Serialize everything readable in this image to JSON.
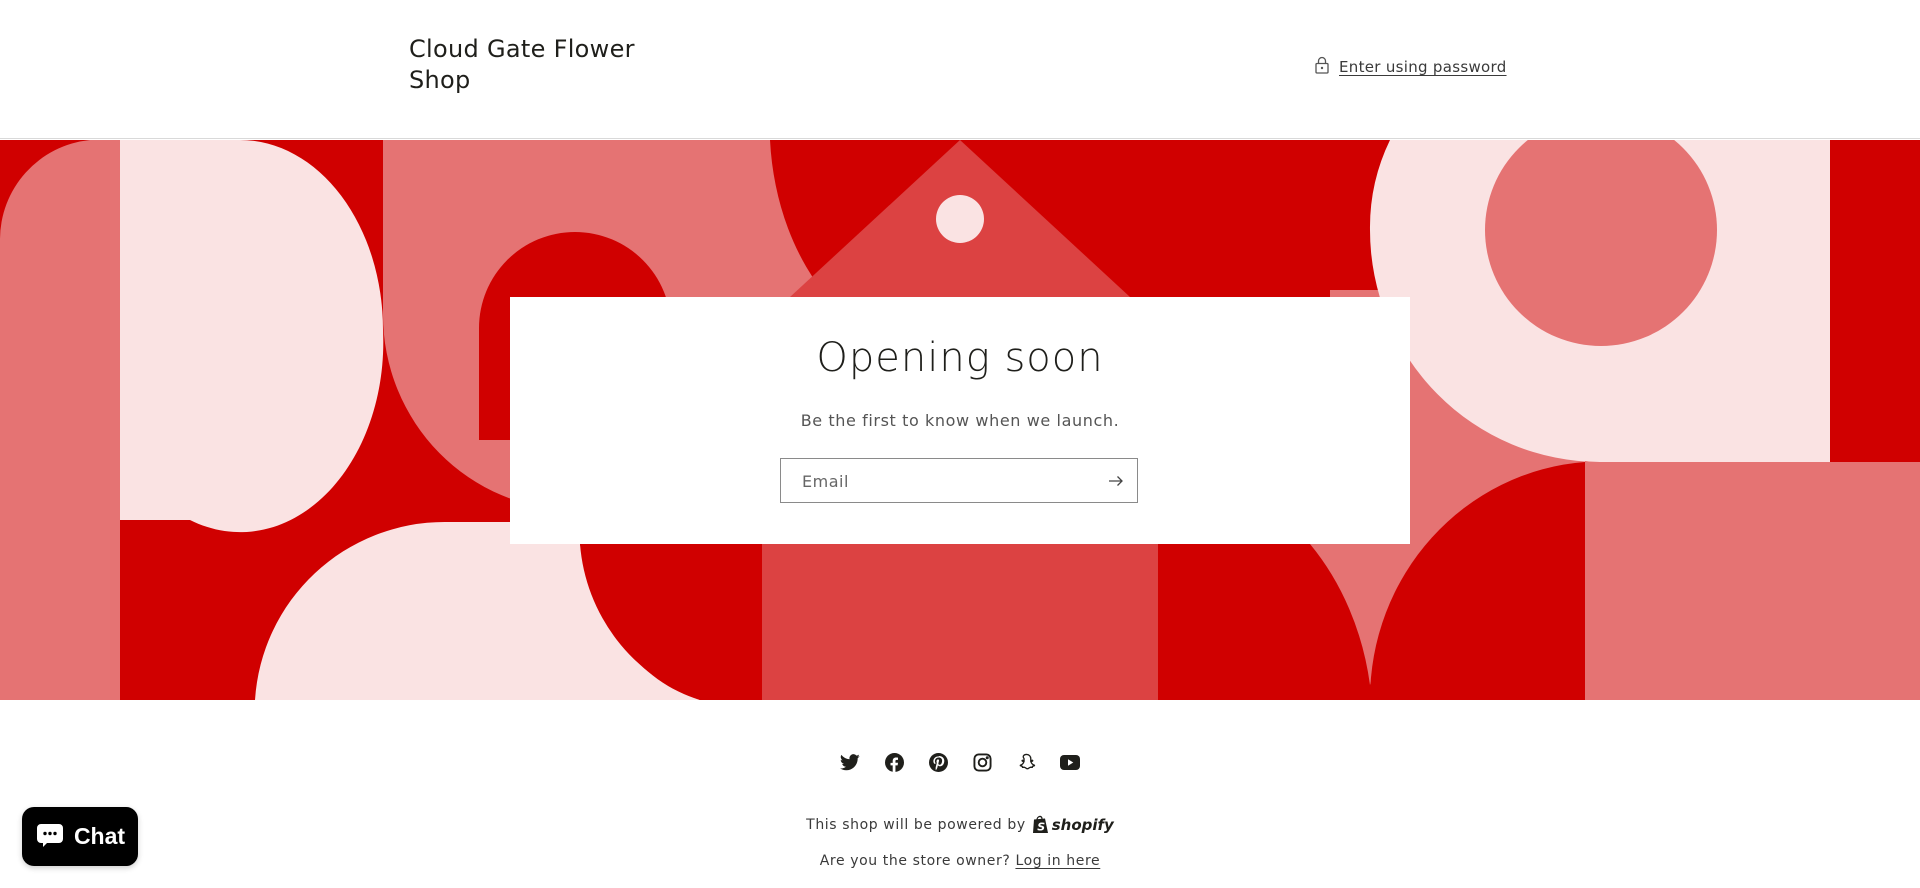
{
  "header": {
    "shop_name": "Cloud Gate Flower Shop",
    "password_link": "Enter using password",
    "password_icon": "lock-icon"
  },
  "banner": {
    "colors": {
      "red": "#D00000",
      "coral": "#E57373",
      "tomato": "#DC4242",
      "pale_pink": "#FAE3E3"
    }
  },
  "newsletter": {
    "title": "Opening soon",
    "subtitle": "Be the first to know when we launch.",
    "email_placeholder": "Email",
    "email_value": "",
    "submit_icon": "arrow-right-icon"
  },
  "footer": {
    "social": [
      {
        "name": "Twitter",
        "icon": "twitter-icon"
      },
      {
        "name": "Facebook",
        "icon": "facebook-icon"
      },
      {
        "name": "Pinterest",
        "icon": "pinterest-icon"
      },
      {
        "name": "Instagram",
        "icon": "instagram-icon"
      },
      {
        "name": "Snapchat",
        "icon": "snapchat-icon"
      },
      {
        "name": "YouTube",
        "icon": "youtube-icon"
      }
    ],
    "powered_by": "This shop will be powered by",
    "shopify_label": "shopify",
    "owner_question": "Are you the store owner?",
    "login_link": "Log in here"
  },
  "chat": {
    "label": "Chat",
    "icon": "chat-bubble-icon"
  }
}
